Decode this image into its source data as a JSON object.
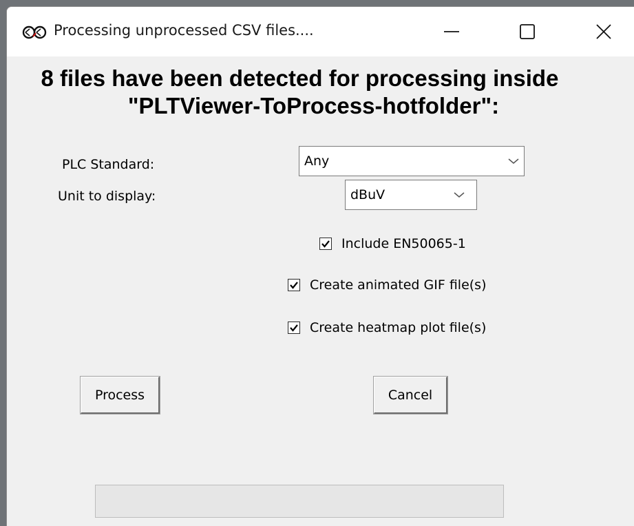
{
  "window": {
    "title": "Processing unprocessed CSV files....",
    "app_icon": "link-icon",
    "controls": [
      "minimize-icon",
      "maximize-icon",
      "close-icon"
    ]
  },
  "heading": {
    "line1": "8 files have been detected for processing inside",
    "line2": "\"PLTViewer-ToProcess-hotfolder\":"
  },
  "form": {
    "plc_standard_label": "PLC Standard:",
    "plc_standard_value": "Any",
    "unit_label": "Unit to display:",
    "unit_value": "dBuV"
  },
  "options": [
    {
      "label": "Include EN50065-1",
      "checked": true
    },
    {
      "label": "Create animated GIF file(s)",
      "checked": true
    },
    {
      "label": "Create heatmap plot file(s)",
      "checked": true
    }
  ],
  "buttons": {
    "process": "Process",
    "cancel": "Cancel"
  },
  "progress": {
    "value": 0
  },
  "colors": {
    "window_bg": "#f0f0f0",
    "titlebar_bg": "#ffffff",
    "progress_fill": "#06b025"
  }
}
